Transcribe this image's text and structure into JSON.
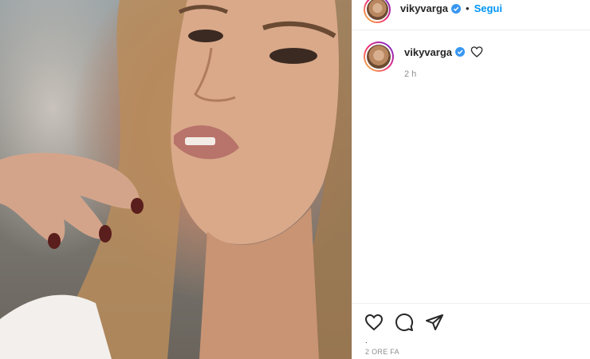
{
  "post": {
    "photo_alt": "portrait photo",
    "author": "vikyvarga",
    "separator": "•",
    "follow_label": "Segui"
  },
  "caption": {
    "username": "vikyvarga",
    "time": "2 h"
  },
  "footer": {
    "dot": ".",
    "timestamp": "2 ORE FA"
  },
  "icons": {
    "verified": "verified-badge-icon",
    "like": "heart-icon",
    "comment": "comment-bubble-icon",
    "share": "paper-plane-icon"
  },
  "colors": {
    "accent": "#0095f6",
    "verified": "#3897f0",
    "muted": "#8e8e8e",
    "text": "#262626"
  }
}
